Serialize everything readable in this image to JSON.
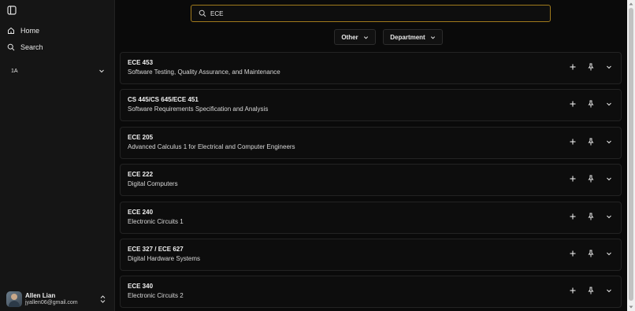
{
  "sidebar": {
    "nav": [
      {
        "label": "Home",
        "icon": "home-icon"
      },
      {
        "label": "Search",
        "icon": "search-icon"
      }
    ],
    "term": "1A",
    "user": {
      "name": "Allen Lian",
      "email": "jyallen06@gmail.com"
    }
  },
  "search": {
    "value": "ECE",
    "placeholder": "ECE"
  },
  "filters": {
    "other": "Other",
    "department": "Department"
  },
  "courses": [
    {
      "code": "ECE 453",
      "name": "Software Testing, Quality Assurance, and Maintenance"
    },
    {
      "code": "CS 445/CS 645/ECE 451",
      "name": "Software Requirements Specification and Analysis"
    },
    {
      "code": "ECE 205",
      "name": "Advanced Calculus 1 for Electrical and Computer Engineers"
    },
    {
      "code": "ECE 222",
      "name": "Digital Computers"
    },
    {
      "code": "ECE 240",
      "name": "Electronic Circuits 1"
    },
    {
      "code": "ECE 327 / ECE 627",
      "name": "Digital Hardware Systems"
    },
    {
      "code": "ECE 340",
      "name": "Electronic Circuits 2"
    }
  ],
  "colors": {
    "accent_border": "#a07a1c",
    "background": "#0a0a0a",
    "sidebar": "#151515"
  }
}
